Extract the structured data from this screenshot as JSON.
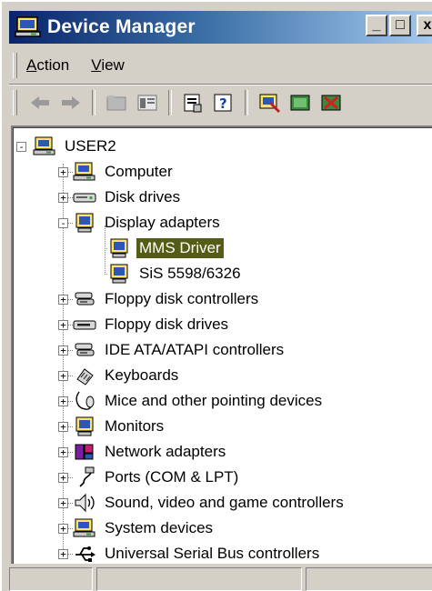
{
  "window": {
    "title": "Device Manager",
    "controls": {
      "minimize": "_",
      "maximize": "□",
      "close": "x"
    }
  },
  "menubar": {
    "items": [
      {
        "label": "Action",
        "hotkey": "A",
        "rest": "ction"
      },
      {
        "label": "View",
        "hotkey": "V",
        "rest": "iew"
      }
    ]
  },
  "toolbar": {
    "items": [
      {
        "icon": "back-arrow-icon"
      },
      {
        "icon": "forward-arrow-icon"
      },
      {
        "icon": "up-folder-icon"
      },
      {
        "icon": "show-hide-tree-icon"
      },
      {
        "icon": "properties-icon"
      },
      {
        "icon": "help-icon"
      },
      {
        "icon": "scan-hardware-icon"
      },
      {
        "icon": "update-driver-icon"
      },
      {
        "icon": "uninstall-icon"
      }
    ]
  },
  "tree": {
    "root": {
      "label": "USER2",
      "icon": "computer-icon",
      "expanded": true
    },
    "nodes": [
      {
        "label": "Computer",
        "icon": "computer-icon",
        "level": 1,
        "expander": "+"
      },
      {
        "label": "Disk drives",
        "icon": "disk-drive-icon",
        "level": 1,
        "expander": "+"
      },
      {
        "label": "Display adapters",
        "icon": "monitor-icon",
        "level": 1,
        "expander": "-"
      },
      {
        "label": "MMS Driver",
        "icon": "monitor-icon",
        "level": 2,
        "selected": true
      },
      {
        "label": "SiS 5598/6326",
        "icon": "monitor-icon",
        "level": 2
      },
      {
        "label": "Floppy disk controllers",
        "icon": "controller-icon",
        "level": 1,
        "expander": "+"
      },
      {
        "label": "Floppy disk drives",
        "icon": "floppy-drive-icon",
        "level": 1,
        "expander": "+"
      },
      {
        "label": "IDE ATA/ATAPI controllers",
        "icon": "controller-icon",
        "level": 1,
        "expander": "+"
      },
      {
        "label": "Keyboards",
        "icon": "keyboard-icon",
        "level": 1,
        "expander": "+"
      },
      {
        "label": "Mice and other pointing devices",
        "icon": "mouse-icon",
        "level": 1,
        "expander": "+"
      },
      {
        "label": "Monitors",
        "icon": "monitor-icon",
        "level": 1,
        "expander": "+"
      },
      {
        "label": "Network adapters",
        "icon": "network-icon",
        "level": 1,
        "expander": "+"
      },
      {
        "label": "Ports (COM & LPT)",
        "icon": "port-icon",
        "level": 1,
        "expander": "+"
      },
      {
        "label": "Sound, video and game controllers",
        "icon": "speaker-icon",
        "level": 1,
        "expander": "+"
      },
      {
        "label": "System devices",
        "icon": "computer-icon",
        "level": 1,
        "expander": "+"
      },
      {
        "label": "Universal Serial Bus controllers",
        "icon": "usb-icon",
        "level": 1,
        "expander": "+"
      }
    ]
  },
  "colors": {
    "selection": "#545c15",
    "titlebar_start": "#0a246a",
    "titlebar_end": "#a6caf0",
    "face": "#d4d0c8"
  }
}
